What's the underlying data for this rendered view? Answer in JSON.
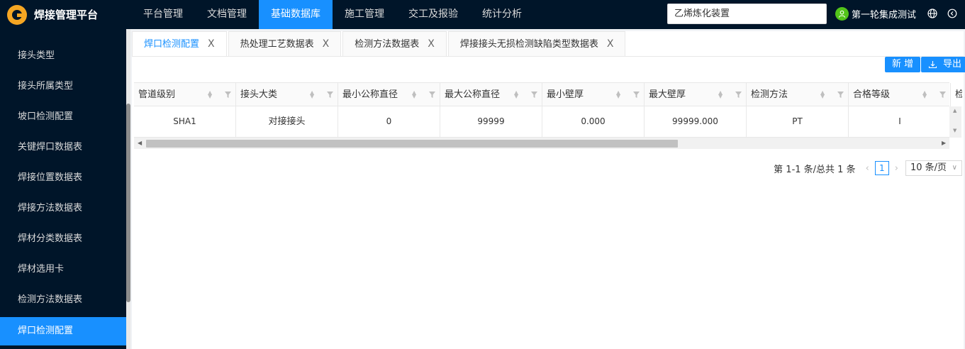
{
  "app": {
    "title": "焊接管理平台"
  },
  "nav": {
    "items": [
      "平台管理",
      "文档管理",
      "基础数据库",
      "施工管理",
      "交工及报验",
      "统计分析"
    ],
    "active_index": 2
  },
  "project_select": {
    "value": "乙烯炼化装置"
  },
  "user": {
    "name": "第一轮集成测试"
  },
  "sidebar": {
    "items": [
      "接头类型",
      "接头所属类型",
      "坡口检测配置",
      "关键焊口数据表",
      "焊接位置数据表",
      "焊接方法数据表",
      "焊材分类数据表",
      "焊材选用卡",
      "检测方法数据表",
      "焊口检测配置"
    ],
    "active_index": 9
  },
  "tabs": {
    "items": [
      "焊口检测配置",
      "热处理工艺数据表",
      "检测方法数据表",
      "焊接接头无损检测缺陷类型数据表"
    ],
    "active_index": 0,
    "close_glyph": "X"
  },
  "toolbar": {
    "add_label": "新 增",
    "export_label": "导出"
  },
  "table": {
    "columns": [
      "管道级别",
      "接头大类",
      "最小公称直径",
      "最大公称直径",
      "最小壁厚",
      "最大壁厚",
      "检测方法",
      "合格等级",
      "检"
    ],
    "rows": [
      [
        "SHA1",
        "对接接头",
        "0",
        "99999",
        "0.000",
        "99999.000",
        "PT",
        "I"
      ]
    ]
  },
  "pagination": {
    "summary": "第 1-1 条/总共 1 条",
    "current_page": "1",
    "page_size": "10 条/页"
  },
  "colors": {
    "header_bg": "#001529",
    "accent": "#1890ff",
    "sidebar_bg": "#001529"
  }
}
